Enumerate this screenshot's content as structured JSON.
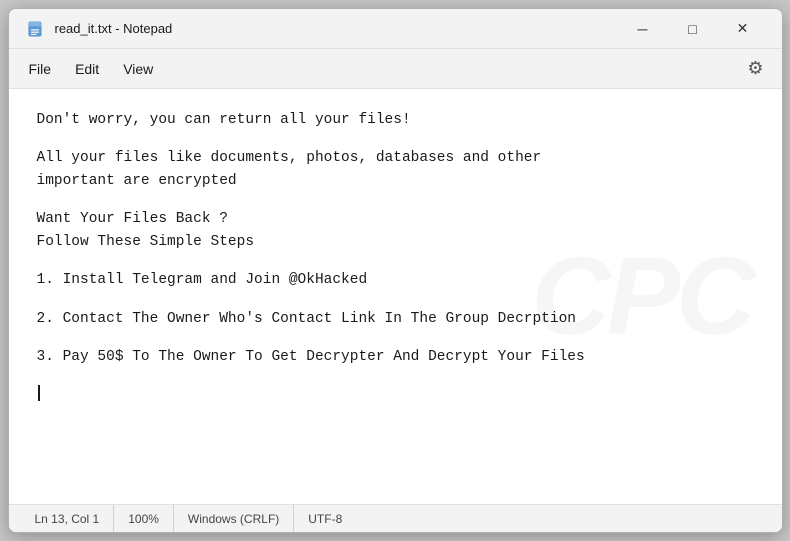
{
  "titleBar": {
    "icon": "notepad-icon",
    "title": "read_it.txt - Notepad",
    "minimizeLabel": "─",
    "maximizeLabel": "□",
    "closeLabel": "✕"
  },
  "menuBar": {
    "items": [
      "File",
      "Edit",
      "View"
    ],
    "gearLabel": "⚙"
  },
  "content": {
    "lines": [
      "Don't worry, you can return all your files!",
      "",
      "All your files like documents, photos, databases and other",
      "important are encrypted",
      "",
      "Want Your Files Back ?",
      "Follow These Simple Steps",
      "",
      "1.  Install Telegram and Join @OkHacked",
      "",
      "2.  Contact The Owner Who's Contact Link In The Group Decrption",
      "",
      "3.  Pay 50$ To The Owner To Get Decrypter And Decrypt Your Files"
    ]
  },
  "statusBar": {
    "position": "Ln 13, Col 1",
    "zoom": "100%",
    "lineEnding": "Windows (CRLF)",
    "encoding": "UTF-8"
  },
  "watermark": "CPC"
}
